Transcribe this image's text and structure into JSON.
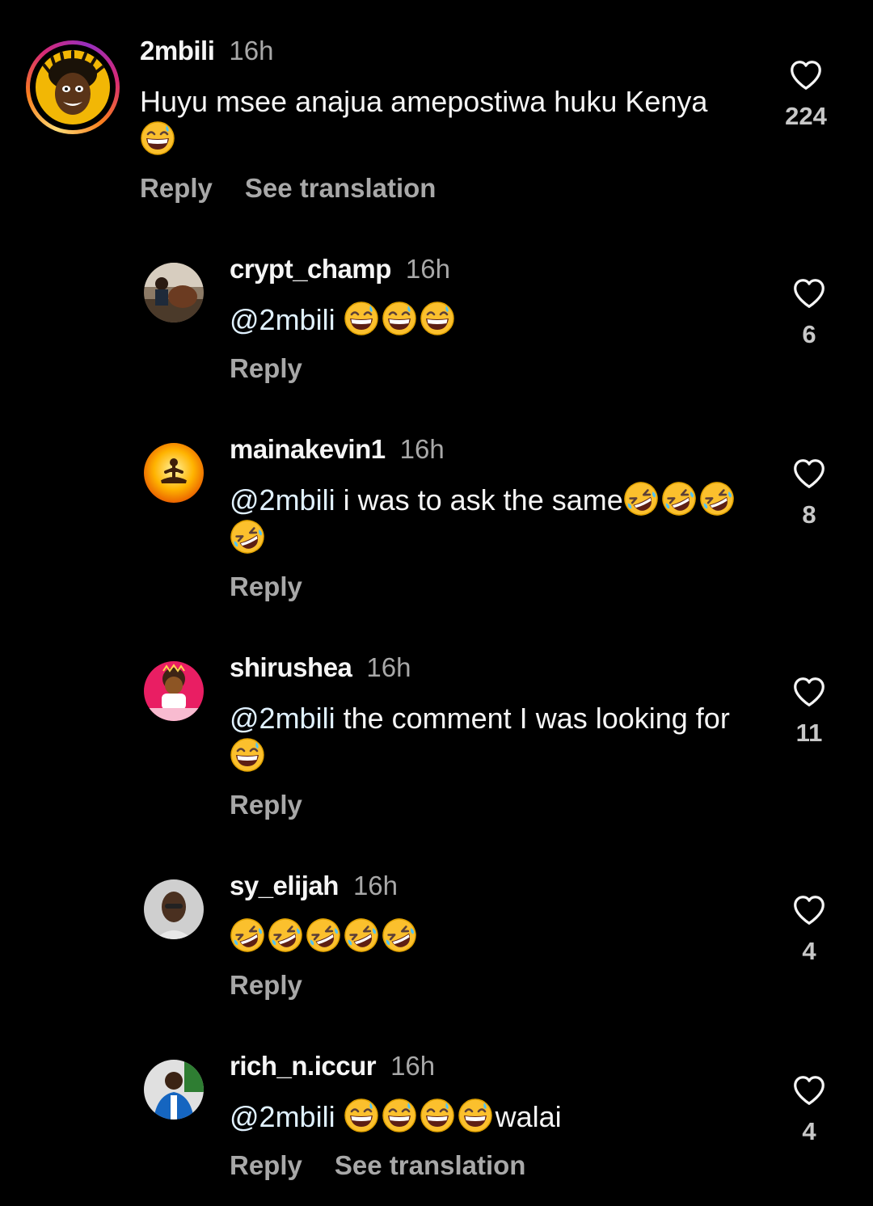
{
  "comments": [
    {
      "username": "2mbili",
      "time": "16h",
      "text": "Huyu msee anajua amepostiwa huku Kenya",
      "mention": "",
      "emoji_after": [
        "grinning-sweat-emoji"
      ],
      "likes": "224",
      "reply_label": "Reply",
      "translation_label": "See translation",
      "has_story_ring": true
    },
    {
      "username": "crypt_champ",
      "time": "16h",
      "mention": "@2mbili",
      "text": "",
      "emoji_after": [
        "grinning-sweat-emoji",
        "grinning-sweat-emoji",
        "grinning-sweat-emoji"
      ],
      "likes": "6",
      "reply_label": "Reply"
    },
    {
      "username": "mainakevin1",
      "time": "16h",
      "mention": "@2mbili",
      "text": "i was to ask the same",
      "emoji_after": [
        "rolling-laughing-emoji",
        "rolling-laughing-emoji",
        "rolling-laughing-emoji",
        "rolling-laughing-emoji"
      ],
      "likes": "8",
      "reply_label": "Reply"
    },
    {
      "username": "shirushea",
      "time": "16h",
      "mention": "@2mbili",
      "text": "the comment I was looking for",
      "emoji_after": [
        "grinning-sweat-emoji"
      ],
      "likes": "11",
      "reply_label": "Reply"
    },
    {
      "username": "sy_elijah",
      "time": "16h",
      "mention": "",
      "text": "",
      "emoji_after": [
        "rolling-laughing-emoji",
        "rolling-laughing-emoji",
        "rolling-laughing-emoji",
        "rolling-laughing-emoji",
        "rolling-laughing-emoji"
      ],
      "likes": "4",
      "reply_label": "Reply"
    },
    {
      "username": "rich_n.iccur",
      "time": "16h",
      "mention": "@2mbili",
      "text": "walai",
      "emoji_before_text": [
        "grinning-sweat-emoji",
        "grinning-sweat-emoji",
        "grinning-sweat-emoji",
        "grinning-sweat-emoji"
      ],
      "likes": "4",
      "reply_label": "Reply",
      "translation_label": "See translation"
    }
  ],
  "icons": {
    "like": "heart-outline-icon"
  },
  "colors": {
    "background": "#000000",
    "primary_text": "#f5f5f5",
    "secondary_text": "#a8a8a8",
    "mention": "#e0f1ff",
    "story_ring": [
      "#feda75",
      "#fa7e1e",
      "#d62976",
      "#962fbf"
    ]
  }
}
